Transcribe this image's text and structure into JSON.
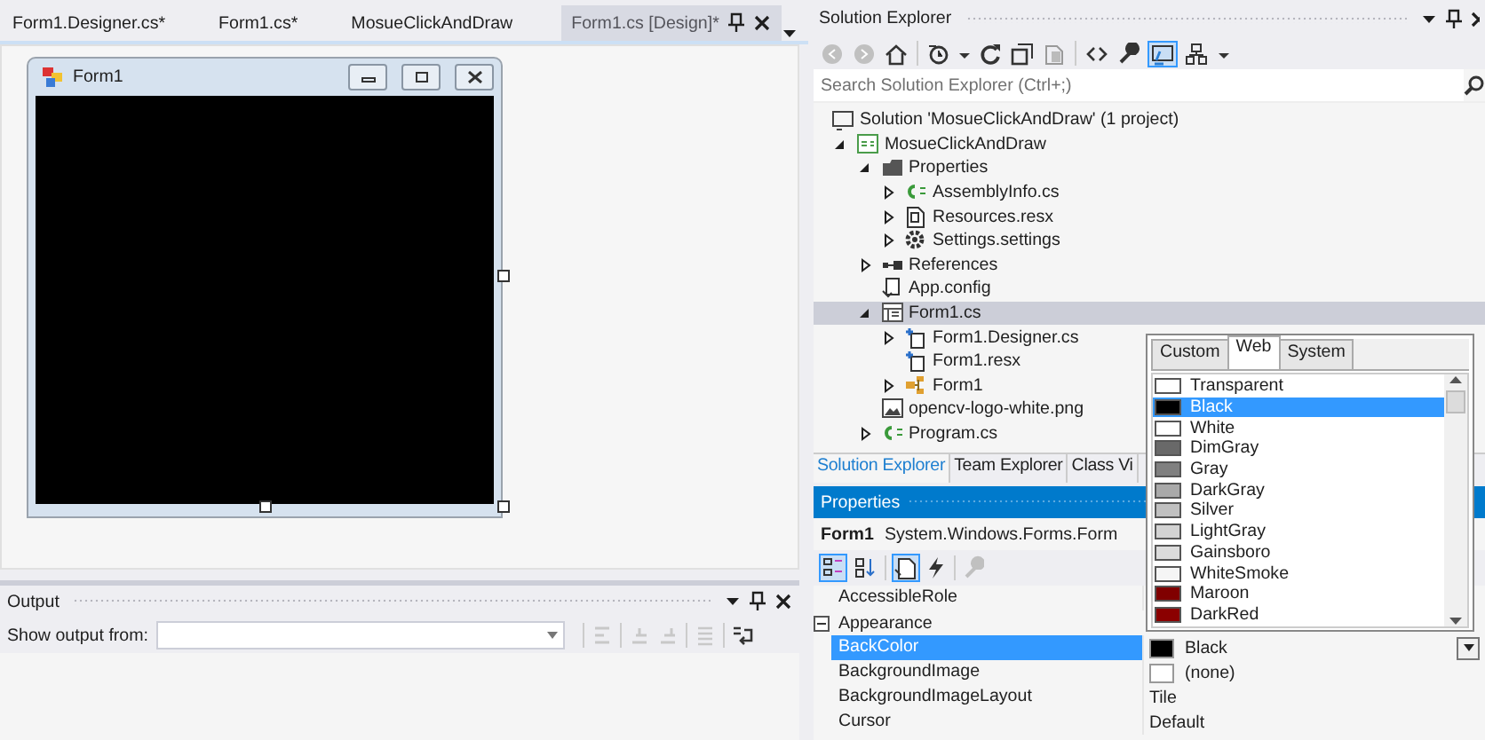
{
  "document_tabs": [
    {
      "label": "Form1.Designer.cs*",
      "selected": false
    },
    {
      "label": "Form1.cs*",
      "selected": false
    },
    {
      "label": "MosueClickAndDraw",
      "selected": false
    },
    {
      "label": "Form1.cs [Design]*",
      "selected": true
    }
  ],
  "form_preview": {
    "title": "Form1"
  },
  "output": {
    "title": "Output",
    "show_output_from": "Show output from:"
  },
  "solution_explorer": {
    "title": "Solution Explorer",
    "search": {
      "placeholder": "Search Solution Explorer (Ctrl+;)"
    },
    "tree": [
      {
        "label": "Solution 'MosueClickAndDraw' (1 project)",
        "kind": "solution",
        "selected": false,
        "children": [
          {
            "label": "MosueClickAndDraw",
            "kind": "project",
            "expanded": true,
            "selected": false,
            "children": [
              {
                "label": "Properties",
                "kind": "properties-folder",
                "expanded": true,
                "selected": false,
                "children": [
                  {
                    "label": "AssemblyInfo.cs",
                    "kind": "csharp",
                    "expanded": false,
                    "selected": false
                  },
                  {
                    "label": "Resources.resx",
                    "kind": "resource",
                    "expanded": false,
                    "selected": false
                  },
                  {
                    "label": "Settings.settings",
                    "kind": "settings",
                    "expanded": false,
                    "selected": false
                  }
                ]
              },
              {
                "label": "References",
                "kind": "references",
                "expanded": false,
                "selected": false
              },
              {
                "label": "App.config",
                "kind": "config",
                "selected": false
              },
              {
                "label": "Form1.cs",
                "kind": "form",
                "expanded": true,
                "selected": true,
                "children": [
                  {
                    "label": "Form1.Designer.cs",
                    "kind": "designer",
                    "expanded": false,
                    "selected": false
                  },
                  {
                    "label": "Form1.resx",
                    "kind": "designer",
                    "selected": false
                  },
                  {
                    "label": "Form1",
                    "kind": "class",
                    "expanded": false,
                    "selected": false
                  }
                ]
              },
              {
                "label": "opencv-logo-white.png",
                "kind": "image",
                "selected": false
              },
              {
                "label": "Program.cs",
                "kind": "csharp",
                "expanded": false,
                "selected": false
              }
            ]
          }
        ]
      }
    ]
  },
  "bottom_tabs": [
    {
      "label": "Solution Explorer",
      "selected": true
    },
    {
      "label": "Team Explorer",
      "selected": false
    },
    {
      "label": "Class Vi",
      "selected": false
    }
  ],
  "properties": {
    "title": "Properties",
    "object_name": "Form1",
    "object_type": "System.Windows.Forms.Form",
    "rows": [
      {
        "kind": "property",
        "name": "AccessibleRole",
        "selected": false
      },
      {
        "kind": "category",
        "name": "Appearance",
        "expanded": true
      },
      {
        "kind": "property",
        "name": "BackColor",
        "value": "Black",
        "color": "#000000",
        "selected": true
      },
      {
        "kind": "property",
        "name": "BackgroundImage",
        "value": "(none)",
        "color": "#ffffff",
        "selected": false
      },
      {
        "kind": "property",
        "name": "BackgroundImageLayout",
        "value": "Tile",
        "selected": false
      },
      {
        "kind": "property",
        "name": "Cursor",
        "value": "Default",
        "selected": false
      }
    ]
  },
  "color_picker": {
    "tabs": [
      {
        "label": "Custom",
        "selected": false
      },
      {
        "label": "Web",
        "selected": true
      },
      {
        "label": "System",
        "selected": false
      }
    ],
    "colors": [
      {
        "name": "Transparent",
        "color": "#ffffff",
        "selected": false
      },
      {
        "name": "Black",
        "color": "#000000",
        "selected": true
      },
      {
        "name": "White",
        "color": "#ffffff",
        "selected": false
      },
      {
        "name": "DimGray",
        "color": "#696969",
        "selected": false
      },
      {
        "name": "Gray",
        "color": "#808080",
        "selected": false
      },
      {
        "name": "DarkGray",
        "color": "#a9a9a9",
        "selected": false
      },
      {
        "name": "Silver",
        "color": "#c0c0c0",
        "selected": false
      },
      {
        "name": "LightGray",
        "color": "#d3d3d3",
        "selected": false
      },
      {
        "name": "Gainsboro",
        "color": "#dcdcdc",
        "selected": false
      },
      {
        "name": "WhiteSmoke",
        "color": "#f5f5f5",
        "selected": false
      },
      {
        "name": "Maroon",
        "color": "#800000",
        "selected": false
      },
      {
        "name": "DarkRed",
        "color": "#8b0000",
        "selected": false
      }
    ]
  }
}
